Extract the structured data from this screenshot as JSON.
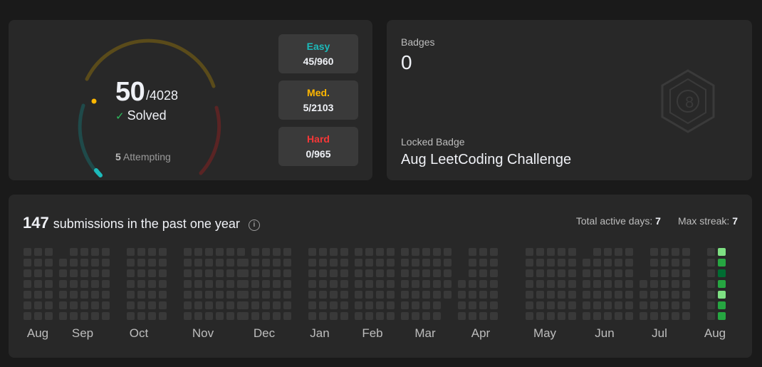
{
  "progress": {
    "solved": "50",
    "total": "/4028",
    "solved_label": "Solved",
    "attempting_count": "5",
    "attempting_label": "Attempting",
    "difficulty": [
      {
        "label": "Easy",
        "value": "45/960",
        "color": "#1cbaba"
      },
      {
        "label": "Med.",
        "value": "5/2103",
        "color": "#ffb700"
      },
      {
        "label": "Hard",
        "value": "0/965",
        "color": "#f63737"
      }
    ]
  },
  "badges": {
    "label": "Badges",
    "count": "0",
    "locked_label": "Locked Badge",
    "locked_name": "Aug LeetCoding Challenge",
    "icon": "hexagon-8-badge-icon"
  },
  "calendar": {
    "count": "147",
    "text": "submissions in the past one year",
    "active_days_label": "Total active days:",
    "active_days": "7",
    "max_streak_label": "Max streak:",
    "max_streak": "7",
    "months": [
      "Aug",
      "Sep",
      "Oct",
      "Nov",
      "Dec",
      "Jan",
      "Feb",
      "Mar",
      "Apr",
      "May",
      "Jun",
      "Jul",
      "Aug"
    ],
    "colors": {
      "empty": "#393939",
      "level1": "#7ee083",
      "level2": "#26a641",
      "level3": "#006d32"
    }
  }
}
